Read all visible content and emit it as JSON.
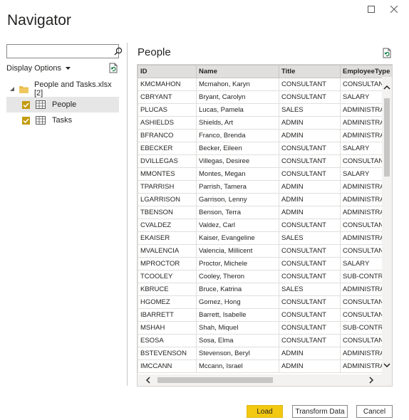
{
  "window": {
    "title": "Navigator"
  },
  "search": {
    "placeholder": "",
    "value": ""
  },
  "display_options": {
    "label": "Display Options"
  },
  "tree": {
    "file": {
      "label": "People and Tasks.xlsx [2]"
    },
    "items": [
      {
        "label": "People",
        "checked": true,
        "selected": true
      },
      {
        "label": "Tasks",
        "checked": true,
        "selected": false
      }
    ]
  },
  "preview": {
    "title": "People",
    "columns": [
      "ID",
      "Name",
      "Title",
      "EmployeeType"
    ],
    "rows": [
      [
        "KMCMAHON",
        "Mcmahon, Karyn",
        "CONSULTANT",
        "CONSULTANT"
      ],
      [
        "CBRYANT",
        "Bryant, Carolyn",
        "CONSULTANT",
        "SALARY"
      ],
      [
        "PLUCAS",
        "Lucas, Pamela",
        "SALES",
        "ADMINISTRATIVE"
      ],
      [
        "ASHIELDS",
        "Shields, Art",
        "ADMIN",
        "ADMINISTRATIVE"
      ],
      [
        "BFRANCO",
        "Franco, Brenda",
        "ADMIN",
        "ADMINISTRATIVE"
      ],
      [
        "EBECKER",
        "Becker, Eileen",
        "CONSULTANT",
        "SALARY"
      ],
      [
        "DVILLEGAS",
        "Villegas, Desiree",
        "CONSULTANT",
        "CONSULTANT"
      ],
      [
        "MMONTES",
        "Montes, Megan",
        "CONSULTANT",
        "SALARY"
      ],
      [
        "TPARRISH",
        "Parrish, Tamera",
        "ADMIN",
        "ADMINISTRATIVE"
      ],
      [
        "LGARRISON",
        "Garrison, Lenny",
        "ADMIN",
        "ADMINISTRATIVE"
      ],
      [
        "TBENSON",
        "Benson, Terra",
        "ADMIN",
        "ADMINISTRATIVE"
      ],
      [
        "CVALDEZ",
        "Valdez, Carl",
        "CONSULTANT",
        "CONSULTANT"
      ],
      [
        "EKAISER",
        "Kaiser, Evangeline",
        "SALES",
        "ADMINISTRATIVE"
      ],
      [
        "MVALENCIA",
        "Valencia, Millicent",
        "CONSULTANT",
        "CONSULTANT"
      ],
      [
        "MPROCTOR",
        "Proctor, Michele",
        "CONSULTANT",
        "SALARY"
      ],
      [
        "TCOOLEY",
        "Cooley, Theron",
        "CONSULTANT",
        "SUB-CONTRACTOR"
      ],
      [
        "KBRUCE",
        "Bruce, Katrina",
        "SALES",
        "ADMINISTRATIVE"
      ],
      [
        "HGOMEZ",
        "Gomez, Hong",
        "CONSULTANT",
        "CONSULTANT"
      ],
      [
        "IBARRETT",
        "Barrett, Isabelle",
        "CONSULTANT",
        "CONSULTANT"
      ],
      [
        "MSHAH",
        "Shah, Miquel",
        "CONSULTANT",
        "SUB-CONTRACTOR"
      ],
      [
        "ESOSA",
        "Sosa, Elma",
        "CONSULTANT",
        "CONSULTANT"
      ],
      [
        "BSTEVENSON",
        "Stevenson, Beryl",
        "ADMIN",
        "ADMINISTRATIVE"
      ],
      [
        "IMCCANN",
        "Mccann, Israel",
        "ADMIN",
        "ADMINISTRATIVE"
      ]
    ]
  },
  "buttons": {
    "load": "Load",
    "transform": "Transform Data",
    "cancel": "Cancel"
  },
  "colors": {
    "accent": "#f2c811",
    "checkbox": "#c29b0f"
  }
}
